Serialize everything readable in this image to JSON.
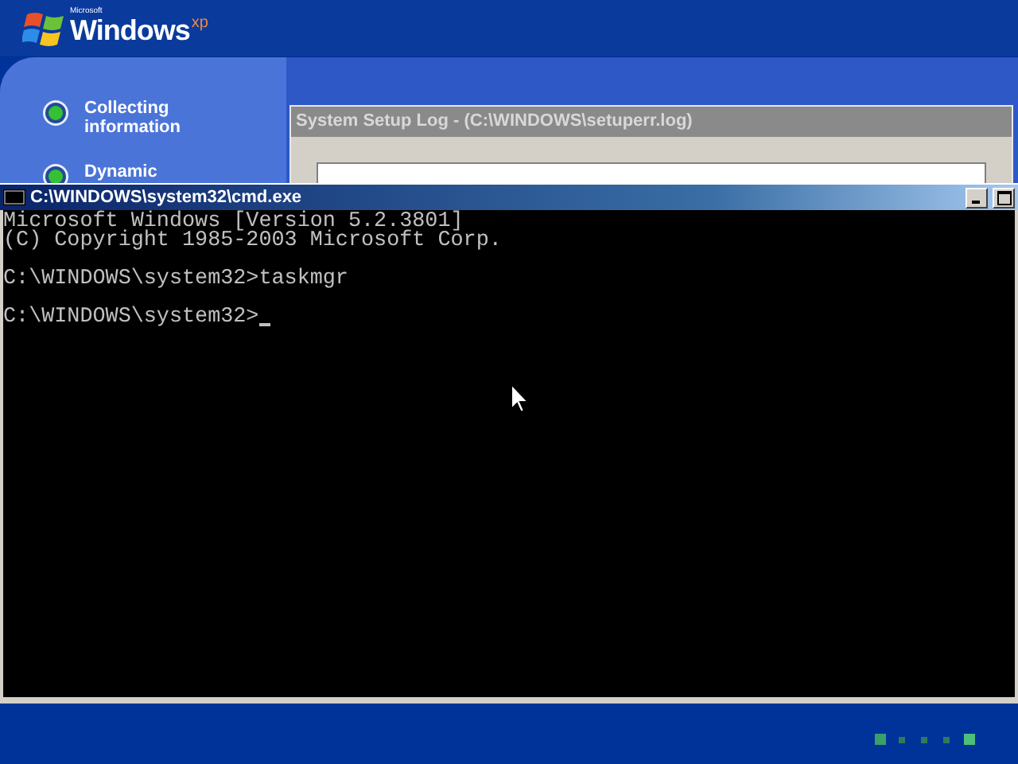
{
  "logo": {
    "maker": "Microsoft",
    "name": "Windows",
    "edition": "xp"
  },
  "setup_steps": [
    {
      "label": "Collecting information"
    },
    {
      "label": "Dynamic"
    }
  ],
  "log_dialog": {
    "title": "System Setup Log - (C:\\WINDOWS\\setuperr.log)"
  },
  "console": {
    "title": "C:\\WINDOWS\\system32\\cmd.exe",
    "lines": [
      {
        "text": "Microsoft Windows [Version 5.2.3801]",
        "blank_before": false,
        "cursor": false
      },
      {
        "text": "(C) Copyright 1985-2003 Microsoft Corp.",
        "blank_before": false,
        "cursor": false
      },
      {
        "text": "C:\\WINDOWS\\system32>taskmgr",
        "blank_before": true,
        "cursor": false
      },
      {
        "text": "C:\\WINDOWS\\system32>",
        "blank_before": true,
        "cursor": true
      }
    ]
  }
}
